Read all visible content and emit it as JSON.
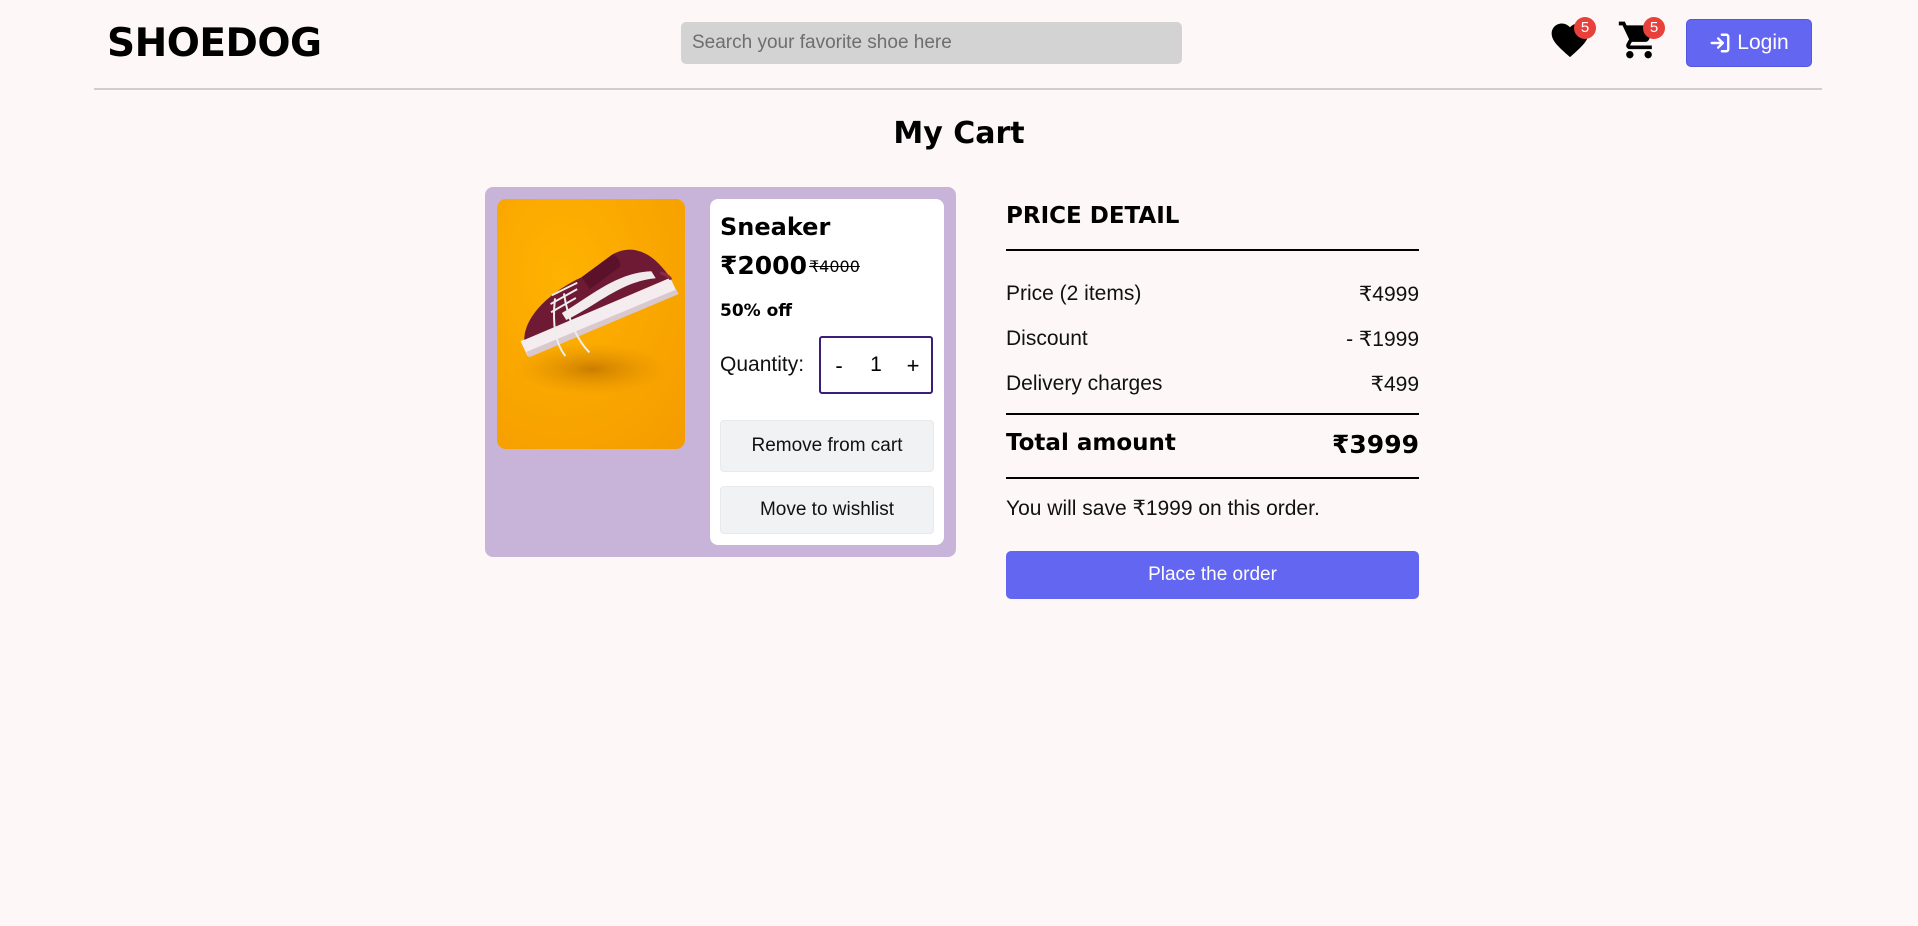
{
  "header": {
    "logo": "SHOEDOG",
    "search_placeholder": "Search your favorite shoe here",
    "wishlist_count": "5",
    "cart_count": "5",
    "login_label": "Login"
  },
  "page_title": "My Cart",
  "cart_item": {
    "name": "Sneaker",
    "price": "₹2000",
    "original_price": "₹4000",
    "discount": "50% off",
    "quantity_label": "Quantity:",
    "quantity": "1",
    "minus_label": "-",
    "plus_label": "+",
    "remove_label": "Remove from cart",
    "wishlist_label": "Move to wishlist"
  },
  "price_detail": {
    "title": "PRICE DETAIL",
    "price_label": "Price (2 items)",
    "price_value": "₹4999",
    "discount_label": "Discount",
    "discount_value": "- ₹1999",
    "delivery_label": "Delivery charges",
    "delivery_value": "₹499",
    "total_label": "Total amount",
    "total_value": "₹3999",
    "savings_text": "You will save ₹1999 on this order.",
    "order_label": "Place the order"
  },
  "colors": {
    "accent": "#6366f1",
    "badge": "#e8413c",
    "card_bg": "#c8b4d9",
    "page_bg": "#fdf8f7"
  },
  "icons": [
    "heart-icon",
    "cart-icon",
    "login-icon",
    "sneaker-image"
  ]
}
